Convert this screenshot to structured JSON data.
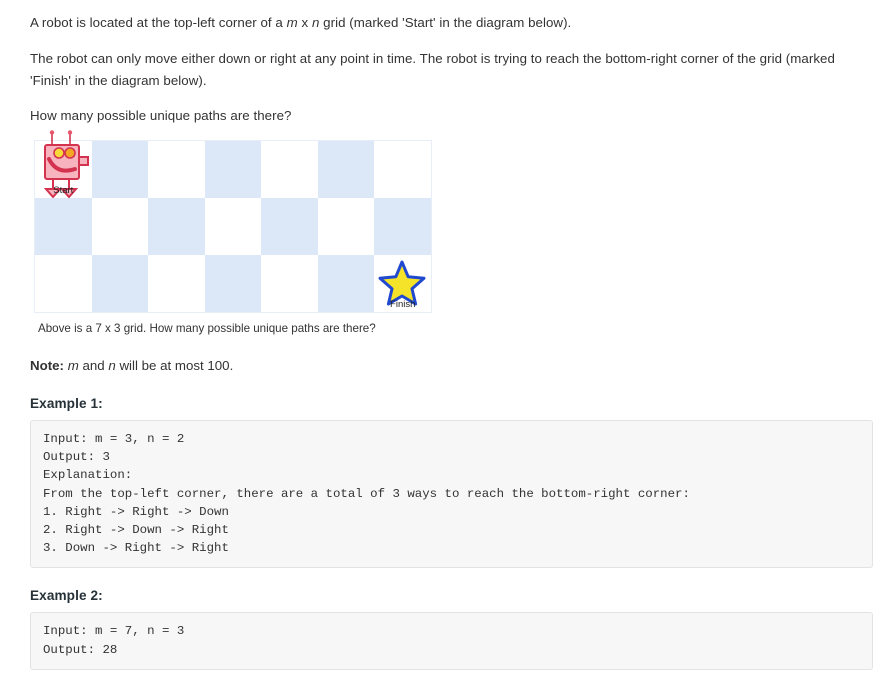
{
  "problem": {
    "paragraph1_a": "A robot is located at the top-left corner of a ",
    "paragraph1_m": "m",
    "paragraph1_x": " x ",
    "paragraph1_n": "n",
    "paragraph1_b": " grid (marked 'Start' in the diagram below).",
    "paragraph2": "The robot can only move either down or right at any point in time. The robot is trying to reach the bottom-right corner of the grid (marked 'Finish' in the diagram below).",
    "paragraph3": "How many possible unique paths are there?"
  },
  "diagram": {
    "start_label": "Start",
    "finish_label": "Finish",
    "caption": "Above is a 7 x 3 grid. How many possible unique paths are there?",
    "columns": 7,
    "rows": 3,
    "cell_colors": [
      [
        "white",
        "blue",
        "white",
        "blue",
        "white",
        "blue",
        "white"
      ],
      [
        "blue",
        "white",
        "blue",
        "white",
        "blue",
        "white",
        "blue"
      ],
      [
        "white",
        "blue",
        "white",
        "blue",
        "white",
        "blue",
        "white"
      ]
    ],
    "blue_hex": "#dce8f8",
    "white_hex": "#ffffff",
    "robot_icon": "robot-icon",
    "star_icon": "star-icon",
    "robot_color": "#f4a0ad",
    "robot_outline": "#d4334f",
    "star_fill": "#f5e32a",
    "star_outline": "#2049d0"
  },
  "note": {
    "label": "Note:",
    "text_a": " ",
    "m": "m",
    "text_b": " and ",
    "n": "n",
    "text_c": " will be at most 100."
  },
  "examples": [
    {
      "title": "Example 1:",
      "code": "Input: m = 3, n = 2\nOutput: 3\nExplanation:\nFrom the top-left corner, there are a total of 3 ways to reach the bottom-right corner:\n1. Right -> Right -> Down\n2. Right -> Down -> Right\n3. Down -> Right -> Right"
    },
    {
      "title": "Example 2:",
      "code": "Input: m = 7, n = 3\nOutput: 28"
    }
  ]
}
